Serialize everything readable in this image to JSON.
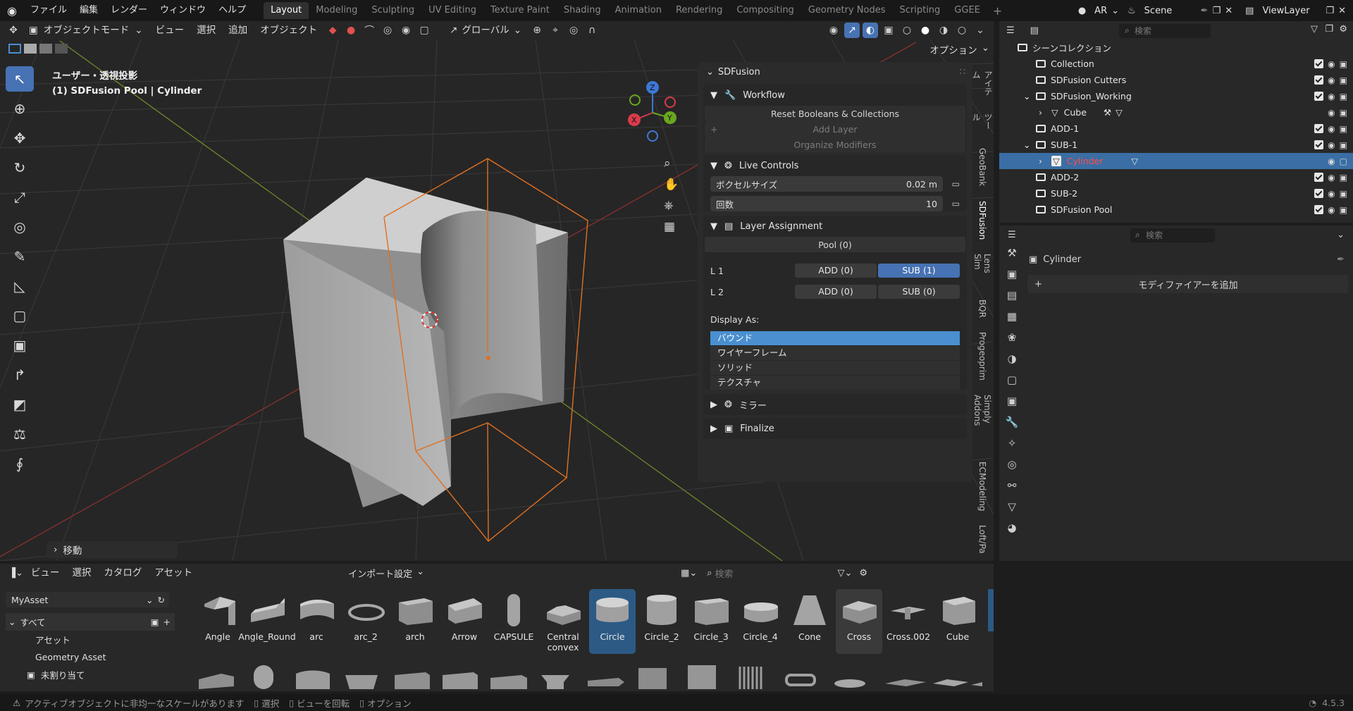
{
  "topbar": {
    "menus": [
      "ファイル",
      "編集",
      "レンダー",
      "ウィンドウ",
      "ヘルプ"
    ],
    "workspaces": [
      "Layout",
      "Modeling",
      "Sculpting",
      "UV Editing",
      "Texture Paint",
      "Shading",
      "Animation",
      "Rendering",
      "Compositing",
      "Geometry Nodes",
      "Scripting",
      "GGEE"
    ],
    "active_workspace": "Layout",
    "ar_label": "AR",
    "scene_label": "Scene",
    "viewlayer_label": "ViewLayer"
  },
  "viewport": {
    "mode": "オブジェクトモード",
    "menus": [
      "ビュー",
      "選択",
      "追加",
      "オブジェクト"
    ],
    "transform_orientation": "グローバル",
    "options": "オプション",
    "info_line1": "ユーザー・透視投影",
    "info_line2": "(1) SDFusion Pool | Cylinder",
    "last_op": "移動",
    "axis_labels": {
      "z": "Z",
      "y": "Y",
      "x": "X"
    },
    "side_tabs": [
      "アイテム",
      "ツール",
      "GeoBank",
      "SDFusion",
      "Lens Sim",
      "BQR",
      "Progeoprim",
      "Simply Addons",
      "ECModeling",
      "Loft/Pa"
    ],
    "active_side_tab": "SDFusion"
  },
  "npanel": {
    "title": "SDFusion",
    "workflow": {
      "title": "Workflow",
      "reset": "Reset Booleans & Collections",
      "add_layer": "Add Layer",
      "organize": "Organize Modifiers"
    },
    "live_controls": {
      "title": "Live Controls",
      "voxel_label": "ボクセルサイズ",
      "voxel_value": "0.02 m",
      "iter_label": "回数",
      "iter_value": "10"
    },
    "layer_assignment": {
      "title": "Layer Assignment",
      "pool": "Pool (0)",
      "layers": [
        {
          "label": "L 1",
          "add": "ADD (0)",
          "sub": "SUB (1)",
          "sub_on": true
        },
        {
          "label": "L 2",
          "add": "ADD (0)",
          "sub": "SUB (0)",
          "sub_on": false
        }
      ],
      "display_as_label": "Display As:",
      "display_options": [
        "バウンド",
        "ワイヤーフレーム",
        "ソリッド",
        "テクスチャ"
      ],
      "display_selected": "バウンド"
    },
    "mirror": "ミラー",
    "finalize": "Finalize"
  },
  "outliner": {
    "search_placeholder": "検索",
    "rows": [
      {
        "name": "シーンコレクション",
        "type": "scene"
      },
      {
        "name": "Collection",
        "type": "coll"
      },
      {
        "name": "SDFusion Cutters",
        "type": "coll"
      },
      {
        "name": "SDFusion_Working",
        "type": "coll"
      },
      {
        "name": "Cube",
        "type": "mesh"
      },
      {
        "name": "ADD-1",
        "type": "coll"
      },
      {
        "name": "SUB-1",
        "type": "coll"
      },
      {
        "name": "Cylinder",
        "type": "mesh",
        "selected": true
      },
      {
        "name": "ADD-2",
        "type": "coll"
      },
      {
        "name": "SUB-2",
        "type": "coll"
      },
      {
        "name": "SDFusion Pool",
        "type": "coll"
      }
    ]
  },
  "properties": {
    "search_placeholder": "検索",
    "object_name": "Cylinder",
    "add_modifier": "モディファイアーを追加"
  },
  "asset_browser": {
    "menus": [
      "ビュー",
      "選択",
      "カタログ",
      "アセット"
    ],
    "import_settings": "インポート設定",
    "search_placeholder": "検索",
    "library": "MyAsset",
    "catalogs": [
      "すべて",
      "アセット",
      "Geometry Asset",
      "未割り当て"
    ],
    "assets": [
      "Angle",
      "Angle_Round",
      "arc",
      "arc_2",
      "arch",
      "Arrow",
      "CAPSULE",
      "Central convex",
      "Circle",
      "Circle_2",
      "Circle_3",
      "Circle_4",
      "Cone",
      "Cross",
      "Cross.002",
      "Cube"
    ],
    "selected_asset": "Circle",
    "hovered_asset": "Cross"
  },
  "statusbar": {
    "warning": "アクティブオブジェクトに非均一なスケールがあります",
    "select": "選択",
    "rotate": "ビューを回転",
    "options": "オプション",
    "version": "4.5.3"
  }
}
